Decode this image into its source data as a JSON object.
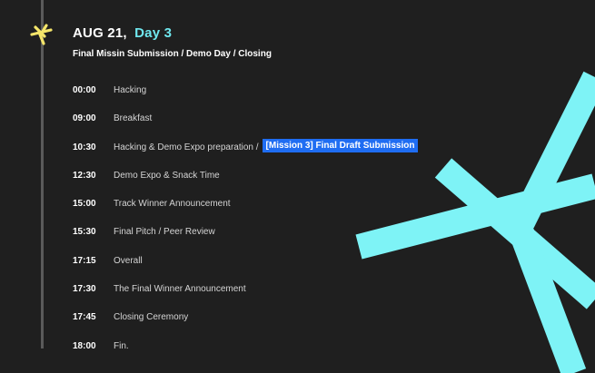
{
  "header": {
    "date": "AUG 21,",
    "day": "Day 3",
    "subtitle": "Final Missin Submission / Demo Day / Closing"
  },
  "schedule": [
    {
      "time": "00:00",
      "event": "Hacking",
      "tag": ""
    },
    {
      "time": "09:00",
      "event": "Breakfast",
      "tag": ""
    },
    {
      "time": "10:30",
      "event": "Hacking & Demo Expo preparation /",
      "tag": "[Mission 3] Final Draft Submission"
    },
    {
      "time": "12:30",
      "event": "Demo Expo & Snack Time",
      "tag": ""
    },
    {
      "time": "15:00",
      "event": "Track Winner Announcement",
      "tag": ""
    },
    {
      "time": "15:30",
      "event": "Final Pitch / Peer Review",
      "tag": ""
    },
    {
      "time": "17:15",
      "event": "Overall",
      "tag": ""
    },
    {
      "time": "17:30",
      "event": "The Final Winner Announcement",
      "tag": ""
    },
    {
      "time": "17:45",
      "event": "Closing Ceremony",
      "tag": ""
    },
    {
      "time": "18:00",
      "event": "Fin.",
      "tag": ""
    }
  ],
  "colors": {
    "background": "#1f1f1f",
    "accent_cyan": "#6fe7ee",
    "marker_yellow": "#f4e56a",
    "highlight_blue": "#1f6df2"
  },
  "icons": {
    "timeline_marker": "asterisk-marker-icon"
  }
}
